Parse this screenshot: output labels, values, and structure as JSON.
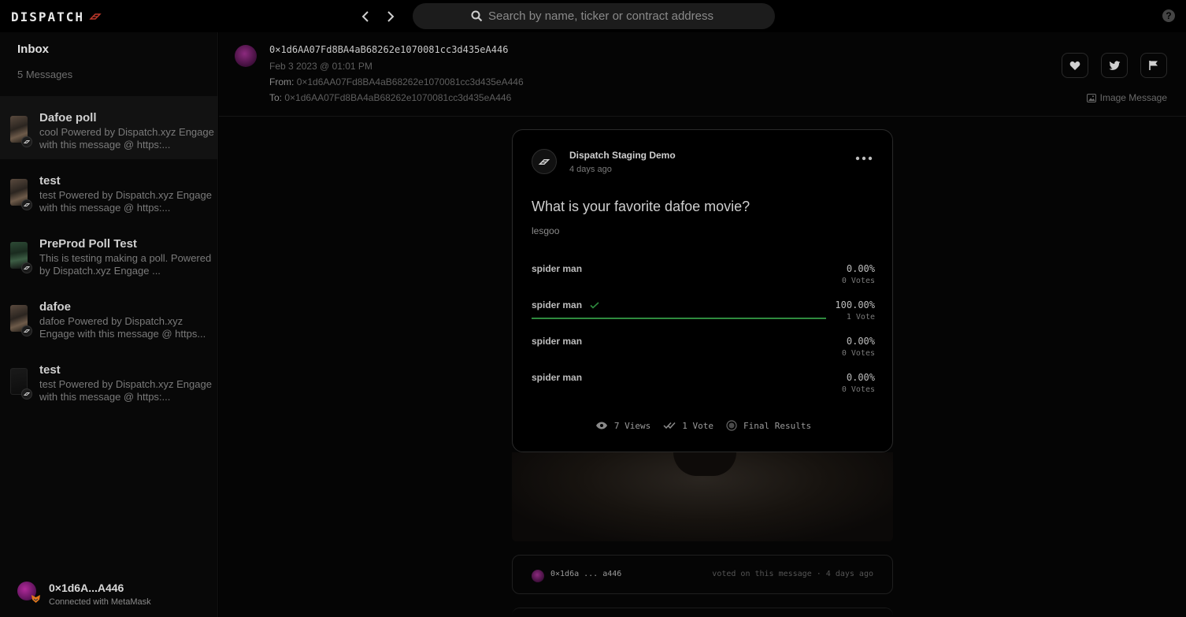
{
  "brand": {
    "name": "DISPATCH"
  },
  "search": {
    "placeholder": "Search by name, ticker or contract address"
  },
  "help": {
    "label": "?"
  },
  "sidebar": {
    "title": "Inbox",
    "count": "5 Messages",
    "items": [
      {
        "title": "Dafoe poll",
        "preview": "cool Powered by Dispatch.xyz Engage with this message @ https:...",
        "active": true
      },
      {
        "title": "test",
        "preview": "test Powered by Dispatch.xyz Engage with this message @ https:..."
      },
      {
        "title": "PreProd Poll Test",
        "preview": "This is testing making a poll. Powered by Dispatch.xyz Engage ..."
      },
      {
        "title": "dafoe",
        "preview": "dafoe Powered by Dispatch.xyz Engage with this message @ https..."
      },
      {
        "title": "test",
        "preview": "test Powered by Dispatch.xyz Engage with this message @ https:..."
      }
    ],
    "account": {
      "address": "0×1d6A...A446",
      "status": "Connected with MetaMask"
    }
  },
  "message": {
    "sender": "0×1d6AA07Fd8BA4aB68262e1070081cc3d435eA446",
    "date": "Feb 3 2023 @ 01:01 PM",
    "from_label": "From:",
    "from": "0×1d6AA07Fd8BA4aB68262e1070081cc3d435eA446",
    "to_label": "To:",
    "to": "0×1d6AA07Fd8BA4aB68262e1070081cc3d435eA446",
    "type_label": "Image Message"
  },
  "poll": {
    "author": "Dispatch Staging Demo",
    "time": "4 days ago",
    "question": "What is your favorite dafoe movie?",
    "description": "lesgoo",
    "options": [
      {
        "label": "spider man",
        "percent": "0.00%",
        "votes": "0 Votes",
        "fraction": 0,
        "selected": false
      },
      {
        "label": "spider man",
        "percent": "100.00%",
        "votes": "1 Vote",
        "fraction": 1,
        "selected": true
      },
      {
        "label": "spider man",
        "percent": "0.00%",
        "votes": "0 Votes",
        "fraction": 0,
        "selected": false
      },
      {
        "label": "spider man",
        "percent": "0.00%",
        "votes": "0 Votes",
        "fraction": 0,
        "selected": false
      }
    ],
    "footer": {
      "views": "7 Views",
      "votes": "1 Vote",
      "status": "Final Results"
    }
  },
  "activity": {
    "address": "0×1d6a ... a446",
    "text": "voted on this message · 4 days ago"
  },
  "colors": {
    "accent_green": "#2e8a3e",
    "brand_red": "#c0392b"
  }
}
